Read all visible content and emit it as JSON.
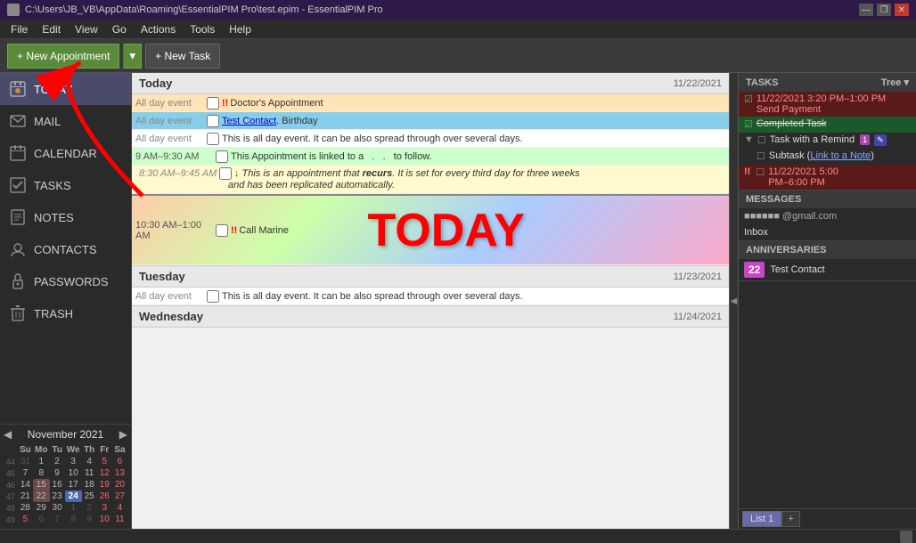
{
  "titlebar": {
    "path": "C:\\Users\\JB_VB\\AppData\\Roaming\\EssentialPIM Pro\\test.epim - EssentialPIM Pro",
    "min": "—",
    "max": "❐",
    "close": "✕"
  },
  "menubar": {
    "items": [
      "File",
      "Edit",
      "View",
      "Go",
      "Actions",
      "Tools",
      "Help"
    ]
  },
  "toolbar": {
    "new_appointment": "+ New Appointment",
    "dropdown": "▾",
    "new_task": "+ New Task"
  },
  "sidebar": {
    "items": [
      {
        "id": "today",
        "label": "TODAY",
        "active": true
      },
      {
        "id": "mail",
        "label": "MAIL",
        "active": false
      },
      {
        "id": "calendar",
        "label": "CALENDAR",
        "active": false
      },
      {
        "id": "tasks",
        "label": "TASKS",
        "active": false
      },
      {
        "id": "notes",
        "label": "NOTES",
        "active": false
      },
      {
        "id": "contacts",
        "label": "CONTACTS",
        "active": false
      },
      {
        "id": "passwords",
        "label": "PASSWORDS",
        "active": false
      },
      {
        "id": "trash",
        "label": "TRASH",
        "active": false
      }
    ]
  },
  "today_section": {
    "title": "Today",
    "date": "11/22/2021",
    "events": [
      {
        "time": "",
        "label": "All day event",
        "priority": "",
        "text": "Doctor's Appointment",
        "style": "highlight-orange",
        "checkbox": true
      },
      {
        "time": "",
        "label": "All day event",
        "priority": "",
        "text": "Test Contact. Birthday",
        "style": "birthday",
        "checkbox": true,
        "link": true
      },
      {
        "time": "",
        "label": "All day event",
        "priority": "",
        "text": "This is all day event. It can be also spread through over several days.",
        "style": "allday",
        "checkbox": true
      },
      {
        "time": "9 AM–9:30 AM",
        "label": "",
        "priority": "",
        "text": "This Appointment is linked to a . . . to follow.",
        "style": "highlight-green",
        "checkbox": true
      },
      {
        "time": "8:30 AM–9:45 AM",
        "label": "",
        "priority": "↓",
        "text": "This is an appointment that recurs. It is set for every third day for three weeks and has been replicated automatically.",
        "style": "recur",
        "checkbox": true
      },
      {
        "time": "10:30 AM–1:00 AM",
        "label": "",
        "priority": "!!",
        "text": "Call Marine",
        "style": "callmarine",
        "checkbox": true
      }
    ],
    "today_text": "TODAY"
  },
  "tuesday_section": {
    "title": "Tuesday",
    "date": "11/23/2021",
    "events": [
      {
        "time": "",
        "label": "All day event",
        "text": "This is all day event. It can be also spread through over several days.",
        "checkbox": true
      }
    ]
  },
  "wednesday_section": {
    "title": "Wednesday",
    "date": "11/24/2021",
    "events": []
  },
  "tasks_panel": {
    "title": "TASKS",
    "view": "Tree ▾",
    "items": [
      {
        "text": "11/22/2021 3:20 PM–1:00 PM Send Payment",
        "style": "red-bg",
        "checked": true,
        "expand": false
      },
      {
        "text": "Completed Task",
        "style": "green-bg",
        "checked": true,
        "expand": false
      },
      {
        "text": "Task with a Remind",
        "badge": "1",
        "style": "normal",
        "checked": false,
        "expand": true
      },
      {
        "text": "Subtask (Link to a Note)",
        "style": "normal",
        "checked": false,
        "expand": false,
        "indent": true
      },
      {
        "text": "11/22/2021 5:00 PM–6:00 PM",
        "style": "red-bg",
        "checked": false,
        "expand": false
      }
    ]
  },
  "messages_panel": {
    "title": "MESSAGES",
    "items": [
      {
        "text": "@gmail.com",
        "prefix": "■■■■■■■■"
      },
      {
        "text": "Inbox"
      }
    ]
  },
  "anniversaries_panel": {
    "title": "ANNIVERSARIES",
    "items": [
      {
        "badge": "22",
        "text": "Test Contact"
      }
    ]
  },
  "list_tabs": {
    "tabs": [
      "List 1"
    ],
    "active": 0,
    "add": "+"
  },
  "calendar_widget": {
    "month": "November",
    "year": "2021",
    "weekdays": [
      "Su",
      "Mo",
      "Tu",
      "We",
      "Th",
      "Fr",
      "Sa"
    ],
    "weeks": [
      {
        "num": "44",
        "days": [
          {
            "d": "31",
            "other": true
          },
          {
            "d": "1"
          },
          {
            "d": "2"
          },
          {
            "d": "3"
          },
          {
            "d": "4"
          },
          {
            "d": "5",
            "red": true
          },
          {
            "d": "6",
            "red": true
          }
        ]
      },
      {
        "num": "45",
        "days": [
          {
            "d": "7"
          },
          {
            "d": "8"
          },
          {
            "d": "9"
          },
          {
            "d": "10"
          },
          {
            "d": "11"
          },
          {
            "d": "12",
            "red": true
          },
          {
            "d": "13",
            "red": true
          }
        ]
      },
      {
        "num": "46",
        "days": [
          {
            "d": "14"
          },
          {
            "d": "15",
            "highlighted": true
          },
          {
            "d": "16"
          },
          {
            "d": "17"
          },
          {
            "d": "18"
          },
          {
            "d": "19",
            "red": true
          },
          {
            "d": "20",
            "red": true
          }
        ]
      },
      {
        "num": "47",
        "days": [
          {
            "d": "21"
          },
          {
            "d": "22",
            "highlighted": true
          },
          {
            "d": "23"
          },
          {
            "d": "24",
            "today": true
          },
          {
            "d": "25"
          },
          {
            "d": "26",
            "red": true
          },
          {
            "d": "27",
            "red": true
          }
        ]
      },
      {
        "num": "48",
        "days": [
          {
            "d": "28"
          },
          {
            "d": "29"
          },
          {
            "d": "30"
          },
          {
            "d": "1",
            "other": true
          },
          {
            "d": "2",
            "other": true
          },
          {
            "d": "3",
            "other": true,
            "red": true
          },
          {
            "d": "4",
            "other": true,
            "red": true
          }
        ]
      },
      {
        "num": "49",
        "days": [
          {
            "d": "5",
            "other": true,
            "red": true
          },
          {
            "d": "6",
            "other": true
          },
          {
            "d": "7",
            "other": true
          },
          {
            "d": "8",
            "other": true
          },
          {
            "d": "9",
            "other": true
          },
          {
            "d": "10",
            "other": true,
            "red": true
          },
          {
            "d": "11",
            "other": true,
            "red": true
          }
        ]
      }
    ]
  },
  "status": {
    "icon": "■"
  }
}
